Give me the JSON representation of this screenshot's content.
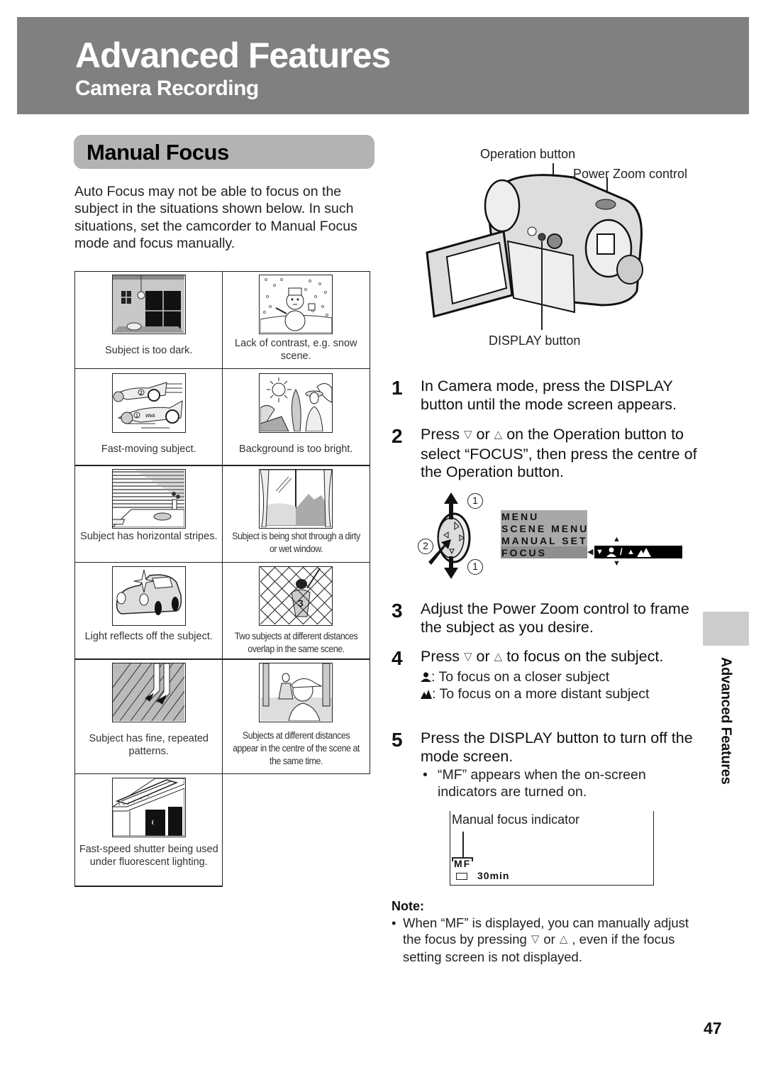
{
  "header": {
    "title": "Advanced Features",
    "subtitle": "Camera Recording",
    "band_color": "#808080"
  },
  "section": {
    "title": "Manual Focus",
    "pill_color": "#b3b3b3",
    "intro": "Auto Focus may not be able to focus on the subject in the situations shown below. In such situations, set the camcorder to Manual Focus mode and focus manually."
  },
  "situations": [
    {
      "illustration": "dark-room-illustration",
      "caption": "Subject is too dark."
    },
    {
      "illustration": "snowman-illustration",
      "caption": "Lack of contrast, e.g. snow scene."
    },
    {
      "illustration": "race-cars-illustration",
      "caption": "Fast-moving subject."
    },
    {
      "illustration": "beach-woman-illustration",
      "caption": "Background is too bright."
    },
    {
      "illustration": "blinds-illustration",
      "caption": "Subject has horizontal stripes."
    },
    {
      "illustration": "wet-window-illustration",
      "caption": "Subject is being shot through a dirty or wet window."
    },
    {
      "illustration": "shiny-car-illustration",
      "caption": "Light reflects off the subject."
    },
    {
      "illustration": "fence-batter-illustration",
      "caption": "Two subjects at different distances overlap in the same scene."
    },
    {
      "illustration": "patterned-floor-illustration",
      "caption": "Subject has fine, repeated patterns."
    },
    {
      "illustration": "two-people-illustration",
      "caption": "Subjects at different distances appear in the centre of the scene at the same time."
    },
    {
      "illustration": "fluorescent-light-illustration",
      "caption": "Fast-speed shutter being used under fluorescent lighting."
    }
  ],
  "camera_diagram": {
    "labels": {
      "operation_button": "Operation button",
      "power_zoom": "Power Zoom control",
      "display_button": "DISPLAY button"
    }
  },
  "steps": [
    {
      "num": "1",
      "text": "In Camera mode, press the DISPLAY button until the mode screen appears."
    },
    {
      "num": "2",
      "pre": "Press",
      "mid": "or",
      "post": "on the Operation button to select “FOCUS”, then press the centre of the Operation button."
    },
    {
      "num": "3",
      "text": "Adjust the Power Zoom control to frame the subject as you desire."
    },
    {
      "num": "4",
      "pre": "Press",
      "mid": "or",
      "post": "to focus on the subject.",
      "sub": [
        {
          "icon": "person-icon",
          "text": ": To focus on a closer subject"
        },
        {
          "icon": "mountain-icon",
          "text": ": To focus on a more distant subject"
        }
      ]
    },
    {
      "num": "5",
      "text": "Press the DISPLAY button to turn off the mode screen.",
      "bullet": "“MF” appears when the on-screen indicators are turned on."
    }
  ],
  "glyphs": {
    "down": "▽",
    "up": "△",
    "bullet": "•"
  },
  "operation_diagram": {
    "callout_1": "1",
    "callout_2": "2",
    "menu": [
      "MENU",
      "SCENE MENU",
      "MANUAL SET",
      "FOCUS"
    ],
    "focus_setting": {
      "left_arrow": "◀",
      "down": "▼",
      "sep": "/",
      "up": "▲"
    }
  },
  "indicator": {
    "label": "Manual focus indicator",
    "mf": "MF",
    "tape_time": "30min"
  },
  "note": {
    "heading": "Note:",
    "pre": "When “MF” is displayed, you can manually adjust the focus by pressing",
    "mid": "or",
    "post": ", even if the focus setting screen is not displayed."
  },
  "side_tab": {
    "label": "Advanced Features",
    "color": "#cccccc"
  },
  "page_number": "47"
}
